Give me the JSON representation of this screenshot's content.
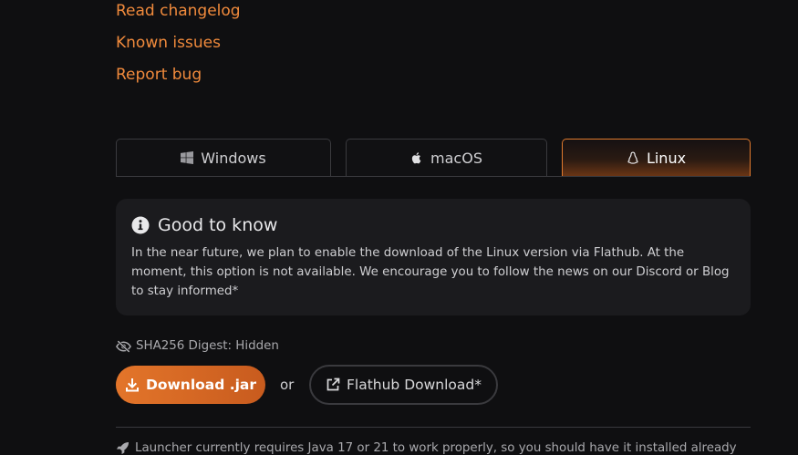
{
  "links": {
    "changelog": "Read changelog",
    "known_issues": "Known issues",
    "report_bug": "Report bug"
  },
  "os_tabs": [
    {
      "label": "Windows",
      "icon": "windows-icon",
      "active": false
    },
    {
      "label": "macOS",
      "icon": "apple-icon",
      "active": false
    },
    {
      "label": "Linux",
      "icon": "linux-icon",
      "active": true
    }
  ],
  "info_card": {
    "icon": "info-icon",
    "title": "Good to know",
    "text": "In the near future, we plan to enable the download of the Linux version via Flathub. At the moment, this option is not available. We encourage you to follow the news on our Discord or Blog to stay informed*"
  },
  "sha": {
    "icon": "eye-slash-icon",
    "label": "SHA256 Digest: Hidden"
  },
  "download": {
    "primary_label": "Download .jar",
    "primary_icon": "download-icon",
    "or_label": "or",
    "secondary_label": "Flathub Download*",
    "secondary_icon": "external-link-icon"
  },
  "footer_note": {
    "icon": "rocket-icon",
    "text": "Launcher currently requires Java 17 or 21 to work properly, so you should have it installed already"
  },
  "colors": {
    "accent": "#f08a3c",
    "background": "#0f0f11",
    "card": "#1b1b1e"
  }
}
